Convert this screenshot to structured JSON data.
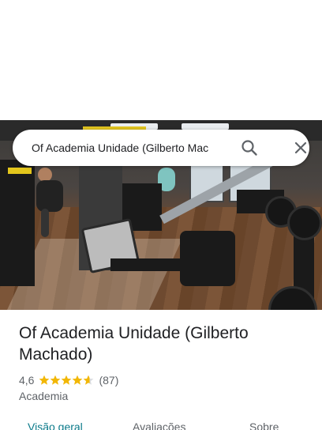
{
  "search": {
    "query": "Of Academia Unidade (Gilberto Mac"
  },
  "place": {
    "name": "Of Academia Unidade (Gilberto Machado)",
    "rating": "4,6",
    "rating_count": "(87)",
    "stars_value": 4.6,
    "category": "Academia"
  },
  "tabs": [
    {
      "label": "Visão geral",
      "active": true
    },
    {
      "label": "Avaliações",
      "active": false
    },
    {
      "label": "Sobre",
      "active": false
    }
  ],
  "colors": {
    "star": "#f2b705",
    "active_tab": "#0b7a8a"
  },
  "icons": {
    "search": "search-icon",
    "close": "close-icon"
  }
}
